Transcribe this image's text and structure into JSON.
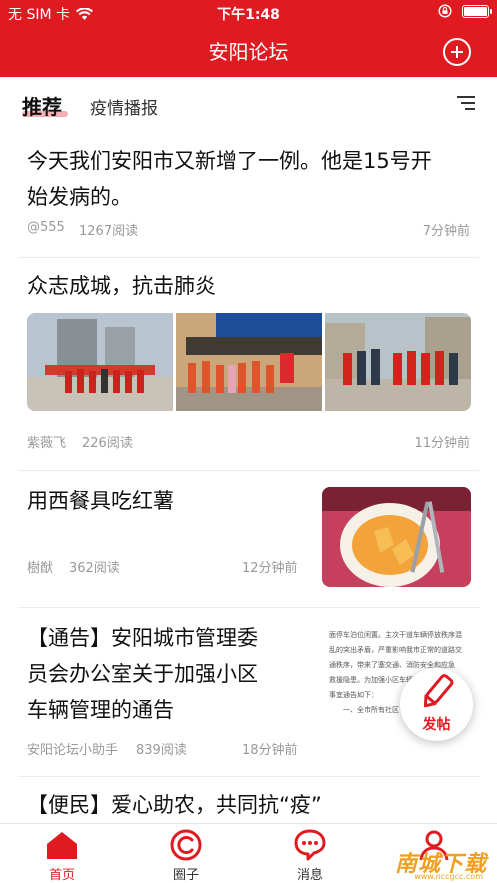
{
  "status_bar": {
    "carrier": "无 SIM 卡",
    "time": "下午1:48",
    "battery_level": 1.0
  },
  "header": {
    "title": "安阳论坛",
    "add_icon": "plus-circle-icon",
    "brand_color": "#df1b21"
  },
  "tabs": {
    "active": "推荐",
    "second": "疫情播报",
    "menu_icon": "sort-menu-icon"
  },
  "feed": [
    {
      "title_line1": "今天我们安阳市又新增了一例。他是15号开",
      "title_line2": "始发病的。",
      "author": "@555",
      "reads": "1267阅读",
      "time": "7分钟前"
    },
    {
      "title": "众志成城，抗击肺炎",
      "author": "紫薇飞",
      "reads": "226阅读",
      "time": "11分钟前",
      "images": [
        "volunteers-street-photo",
        "community-service-center-photo",
        "volunteers-group-photo"
      ]
    },
    {
      "title": "用西餐具吃红薯",
      "author": "樹猷",
      "reads": "362阅读",
      "time": "12分钟前",
      "thumbnail": "sweet-potato-plate-photo"
    },
    {
      "title_line1": "【通告】安阳城市管理委",
      "title_line2": "员会办公室关于加强小区",
      "title_line3": "车辆管理的通告",
      "author": "安阳论坛小助手",
      "reads": "839阅读",
      "time": "18分钟前",
      "thumbnail": "notice-document-photo",
      "doc_lines": [
        "面停车泊位闲置。主次干道车辆停放秩序混",
        "乱的突出矛盾，严重影响我市正常的道路交",
        "通秩序，带来了塞交通、消防安全和应急",
        "救援隐患。为加强小区车辆",
        "事宜通告如下：",
        "一、全市所有社区"
      ]
    },
    {
      "title": "【便民】爱心助农，共同抗“疫”"
    }
  ],
  "fab": {
    "label": "发帖",
    "icon": "pencil-icon"
  },
  "bottom_nav": [
    {
      "label": "首页",
      "icon": "home-icon",
      "active": true
    },
    {
      "label": "圈子",
      "icon": "circle-icon",
      "active": false
    },
    {
      "label": "消息",
      "icon": "message-icon",
      "active": false
    },
    {
      "label": "",
      "icon": "profile-icon",
      "active": false
    }
  ],
  "watermark": {
    "text": "南城下载",
    "url_text": "www.nccgcc.com"
  }
}
